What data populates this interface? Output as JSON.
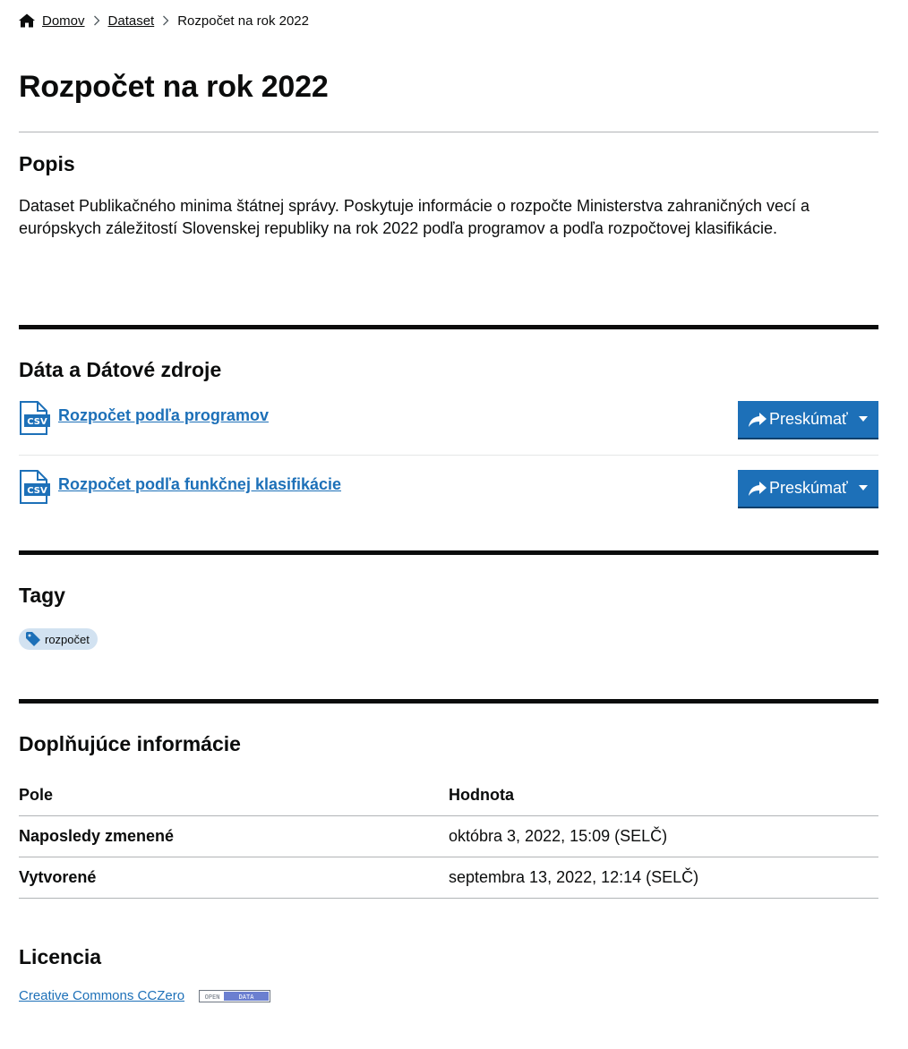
{
  "breadcrumb": {
    "home": "Domov",
    "dataset": "Dataset",
    "current": "Rozpočet na rok 2022"
  },
  "page_title": "Rozpočet na rok 2022",
  "description": {
    "heading": "Popis",
    "text": "Dataset Publikačného minima štátnej správy. Poskytuje informácie o rozpočte Ministerstva zahraničných vecí a európskych záležitostí Slovenskej republiky na rok 2022 podľa programov a podľa rozpočtovej klasifikácie."
  },
  "resources": {
    "heading": "Dáta a Dátové zdroje",
    "items": [
      {
        "title": "Rozpočet podľa programov",
        "format": "CSV",
        "button": "Preskúmať"
      },
      {
        "title": "Rozpočet podľa funkčnej klasifikácie",
        "format": "CSV",
        "button": "Preskúmať"
      }
    ]
  },
  "tags": {
    "heading": "Tagy",
    "items": [
      "rozpočet"
    ]
  },
  "additional_info": {
    "heading": "Doplňujúce informácie",
    "columns": [
      "Pole",
      "Hodnota"
    ],
    "rows": [
      [
        "Naposledy zmenené",
        "októbra 3, 2022, 15:09 (SELČ)"
      ],
      [
        "Vytvorené",
        "septembra 13, 2022, 12:14 (SELČ)"
      ]
    ]
  },
  "license": {
    "heading": "Licencia",
    "link": "Creative Commons CCZero",
    "badge_left": "OPEN",
    "badge_right": "DATA"
  },
  "colors": {
    "link": "#1d70b8",
    "button": "#1d70b8",
    "tag_bg": "#d2e2f1",
    "text": "#0b0c0c"
  },
  "icons": [
    "home-icon",
    "chevron-right-icon",
    "csv-file-icon",
    "share-icon",
    "caret-down-icon",
    "tag-icon",
    "open-data-badge"
  ]
}
